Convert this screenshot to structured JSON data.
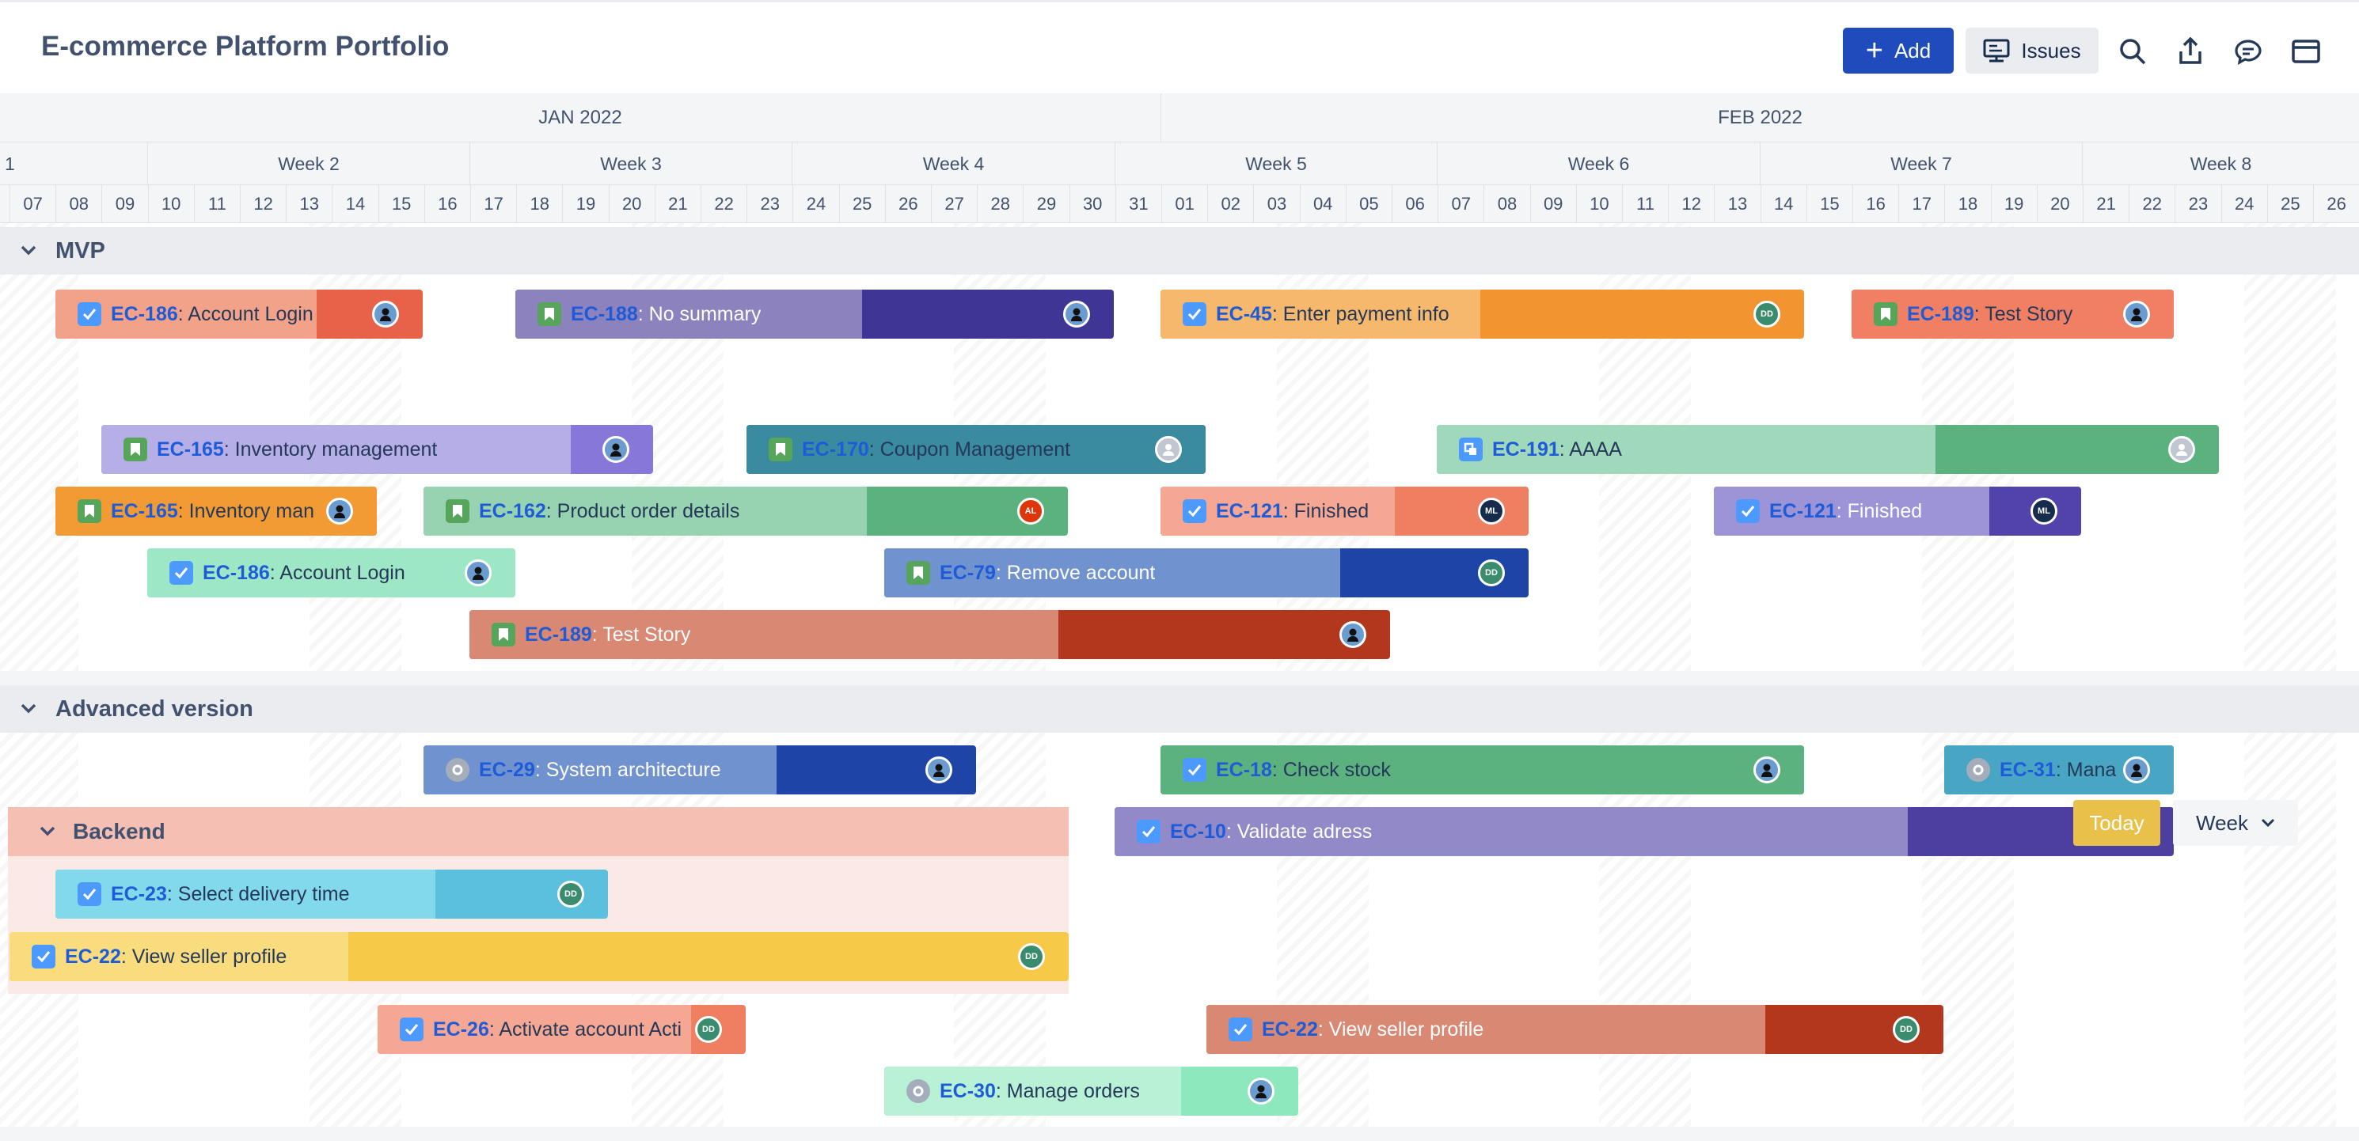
{
  "header": {
    "title": "E-commerce Platform Portfolio",
    "add_label": "Add",
    "issues_label": "Issues",
    "icons": [
      "search-icon",
      "share-icon",
      "comment-icon",
      "panel-icon"
    ]
  },
  "timeline": {
    "months": [
      "JAN 2022",
      "FEB 2022"
    ],
    "weeks": [
      "1",
      "Week 2",
      "Week 3",
      "Week 4",
      "Week 5",
      "Week 6",
      "Week 7",
      "Week 8"
    ],
    "days": [
      "07",
      "08",
      "09",
      "10",
      "11",
      "12",
      "13",
      "14",
      "15",
      "16",
      "17",
      "18",
      "19",
      "20",
      "21",
      "22",
      "23",
      "24",
      "25",
      "26",
      "27",
      "28",
      "29",
      "30",
      "31",
      "01",
      "02",
      "03",
      "04",
      "05",
      "06",
      "07",
      "08",
      "09",
      "10",
      "11",
      "12",
      "13",
      "14",
      "15",
      "16",
      "17",
      "18",
      "19",
      "20",
      "21",
      "22",
      "23",
      "24",
      "25",
      "26"
    ]
  },
  "groups": {
    "mvp": "MVP",
    "advanced": "Advanced version",
    "backend": "Backend"
  },
  "bars": [
    {
      "key": "EC-186",
      "summary": ": Account Login",
      "type": "task",
      "avatar": "person"
    },
    {
      "key": "EC-188",
      "summary": ": No summary",
      "type": "story",
      "avatar": "person"
    },
    {
      "key": "EC-45",
      "summary": ": Enter payment info",
      "type": "task",
      "avatar": "DD"
    },
    {
      "key": "EC-189",
      "summary": ": Test Story",
      "type": "story",
      "avatar": "person"
    },
    {
      "key": "EC-165",
      "summary": ": Inventory management",
      "type": "story",
      "avatar": "person"
    },
    {
      "key": "EC-170",
      "summary": ": Coupon Management",
      "type": "story",
      "avatar": "user"
    },
    {
      "key": "EC-191",
      "summary": ": AAAA",
      "type": "subtask",
      "avatar": "user"
    },
    {
      "key": "EC-165",
      "summary": ": Inventory man",
      "type": "story",
      "avatar": "person"
    },
    {
      "key": "EC-162",
      "summary": ": Product order details",
      "type": "story",
      "avatar": "AL"
    },
    {
      "key": "EC-121",
      "summary": ": Finished",
      "type": "task",
      "avatar": "ML"
    },
    {
      "key": "EC-121",
      "summary": ": Finished",
      "type": "task",
      "avatar": "ML"
    },
    {
      "key": "EC-186",
      "summary": ": Account Login",
      "type": "task",
      "avatar": "person"
    },
    {
      "key": "EC-79",
      "summary": ": Remove account",
      "type": "story",
      "avatar": "DD"
    },
    {
      "key": "EC-189",
      "summary": ": Test Story",
      "type": "story",
      "avatar": "person"
    },
    {
      "key": "EC-29",
      "summary": ": System architecture",
      "type": "other",
      "avatar": "person"
    },
    {
      "key": "EC-18",
      "summary": ": Check stock",
      "type": "task",
      "avatar": "person"
    },
    {
      "key": "EC-31",
      "summary": ": Mana",
      "type": "other",
      "avatar": "person"
    },
    {
      "key": "EC-10",
      "summary": ": Validate adress",
      "type": "task",
      "avatar": "person"
    },
    {
      "key": "EC-23",
      "summary": ": Select delivery time",
      "type": "task",
      "avatar": "DD"
    },
    {
      "key": "EC-22",
      "summary": ": View seller profile",
      "type": "task",
      "avatar": "DD"
    },
    {
      "key": "EC-26",
      "summary": ": Activate account Acti",
      "type": "task",
      "avatar": "DD"
    },
    {
      "key": "EC-22",
      "summary": ": View seller profile",
      "type": "task",
      "avatar": "DD"
    },
    {
      "key": "EC-30",
      "summary": ": Manage orders",
      "type": "other",
      "avatar": "person"
    }
  ],
  "controls": {
    "today_label": "Today",
    "scale_label": "Week"
  }
}
